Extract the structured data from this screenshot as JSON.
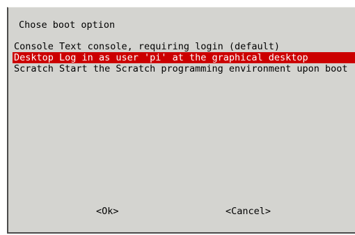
{
  "dialog": {
    "title": "Chose boot option",
    "items": [
      {
        "tag": "Console",
        "description": "Text console, requiring login (default)",
        "selected": false
      },
      {
        "tag": "Desktop",
        "description": "Log in as user 'pi' at the graphical desktop",
        "selected": true
      },
      {
        "tag": "Scratch",
        "description": "Start the Scratch programming environment upon boot",
        "selected": false
      }
    ],
    "buttons": {
      "ok_label": "<Ok>",
      "cancel_label": "<Cancel>"
    }
  },
  "colors": {
    "dialog_background": "#d4d4d0",
    "selection_background": "#cc0000",
    "selection_text": "#ffffff",
    "text": "#000000"
  }
}
